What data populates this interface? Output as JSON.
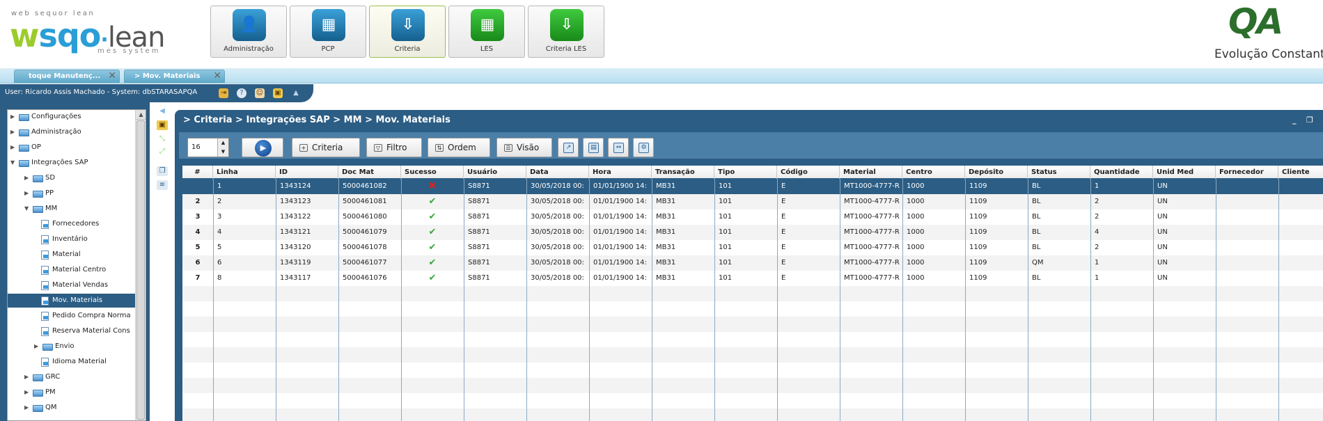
{
  "branding": {
    "tagline": "web sequor lean",
    "logo_w": "w",
    "logo_sqo": "sqo",
    "logo_lean": "lean",
    "logo_sub": "mes system",
    "qa_logo": "QA",
    "slogan": "Evolução Constante"
  },
  "modules": [
    {
      "label": "Administração",
      "icon": "person-icon",
      "color": "blue",
      "glyph": "👤"
    },
    {
      "label": "PCP",
      "icon": "calendar-icon",
      "color": "blue",
      "glyph": "▦"
    },
    {
      "label": "Criteria",
      "icon": "criteria-icon",
      "color": "blue",
      "glyph": "⇩"
    },
    {
      "label": "LES",
      "icon": "grid-icon",
      "color": "green",
      "glyph": "▦"
    },
    {
      "label": "Criteria LES",
      "icon": "criteria-les-icon",
      "color": "green",
      "glyph": "⇩"
    }
  ],
  "tabs": [
    {
      "label": "toque Manutenç..."
    },
    {
      "label": "> Mov. Materiais"
    }
  ],
  "userbar": {
    "text": "User: Ricardo Assis Machado - System: dbSTARASAPQA"
  },
  "tree": [
    {
      "label": "Configurações",
      "level": 0,
      "expander": "▶",
      "type": "folder"
    },
    {
      "label": "Administração",
      "level": 0,
      "expander": "▶",
      "type": "folder"
    },
    {
      "label": "OP",
      "level": 0,
      "expander": "▶",
      "type": "folder"
    },
    {
      "label": "Integrações SAP",
      "level": 0,
      "expander": "▼",
      "type": "folder"
    },
    {
      "label": "SD",
      "level": 1,
      "expander": "▶",
      "type": "folder"
    },
    {
      "label": "PP",
      "level": 1,
      "expander": "▶",
      "type": "folder"
    },
    {
      "label": "MM",
      "level": 1,
      "expander": "▼",
      "type": "folder"
    },
    {
      "label": "Fornecedores",
      "level": 2,
      "expander": "",
      "type": "doc"
    },
    {
      "label": "Inventário",
      "level": 2,
      "expander": "",
      "type": "doc"
    },
    {
      "label": "Material",
      "level": 2,
      "expander": "",
      "type": "doc"
    },
    {
      "label": "Material Centro",
      "level": 2,
      "expander": "",
      "type": "doc"
    },
    {
      "label": "Material Vendas",
      "level": 2,
      "expander": "",
      "type": "doc"
    },
    {
      "label": "Mov. Materiais",
      "level": 2,
      "expander": "",
      "type": "doc",
      "selected": true
    },
    {
      "label": "Pedido Compra Norma",
      "level": 2,
      "expander": "",
      "type": "doc"
    },
    {
      "label": "Reserva Material Cons",
      "level": 2,
      "expander": "",
      "type": "doc"
    },
    {
      "label": "Envio",
      "level": 2,
      "expander": "▶",
      "type": "folder"
    },
    {
      "label": "Idioma Material",
      "level": 2,
      "expander": "",
      "type": "doc"
    },
    {
      "label": "GRC",
      "level": 1,
      "expander": "▶",
      "type": "folder"
    },
    {
      "label": "PM",
      "level": 1,
      "expander": "▶",
      "type": "folder"
    },
    {
      "label": "QM",
      "level": 1,
      "expander": "▶",
      "type": "folder"
    }
  ],
  "panel": {
    "breadcrumb": "> Criteria > Integrações SAP > MM > Mov. Materiais",
    "rows_per_page": "16",
    "buttons": {
      "criteria": "Criteria",
      "filtro": "Filtro",
      "ordem": "Ordem",
      "visao": "Visão"
    }
  },
  "grid": {
    "columns": [
      "#",
      "Linha",
      "ID",
      "Doc Mat",
      "Sucesso",
      "Usuário",
      "Data",
      "Hora",
      "Transação",
      "Tipo",
      "Código",
      "Material",
      "Centro",
      "Depósito",
      "Status",
      "Quantidade",
      "Unid Med",
      "Fornecedor",
      "Cliente"
    ],
    "rows": [
      {
        "idx": "",
        "linha": "1",
        "id": "1343124",
        "docmat": "5000461082",
        "sucesso": false,
        "usuario": "S8871",
        "data": "30/05/2018 00:",
        "hora": "01/01/1900 14:",
        "transacao": "MB31",
        "tipo": "101",
        "codigo": "E",
        "material": "MT1000-4777-R",
        "centro": "1000",
        "deposito": "1109",
        "status": "BL",
        "quantidade": "1",
        "unid": "UN",
        "fornecedor": "",
        "cliente": "",
        "selected": true
      },
      {
        "idx": "2",
        "linha": "2",
        "id": "1343123",
        "docmat": "5000461081",
        "sucesso": true,
        "usuario": "S8871",
        "data": "30/05/2018 00:",
        "hora": "01/01/1900 14:",
        "transacao": "MB31",
        "tipo": "101",
        "codigo": "E",
        "material": "MT1000-4777-R",
        "centro": "1000",
        "deposito": "1109",
        "status": "BL",
        "quantidade": "2",
        "unid": "UN",
        "fornecedor": "",
        "cliente": ""
      },
      {
        "idx": "3",
        "linha": "3",
        "id": "1343122",
        "docmat": "5000461080",
        "sucesso": true,
        "usuario": "S8871",
        "data": "30/05/2018 00:",
        "hora": "01/01/1900 14:",
        "transacao": "MB31",
        "tipo": "101",
        "codigo": "E",
        "material": "MT1000-4777-R",
        "centro": "1000",
        "deposito": "1109",
        "status": "BL",
        "quantidade": "2",
        "unid": "UN",
        "fornecedor": "",
        "cliente": ""
      },
      {
        "idx": "4",
        "linha": "4",
        "id": "1343121",
        "docmat": "5000461079",
        "sucesso": true,
        "usuario": "S8871",
        "data": "30/05/2018 00:",
        "hora": "01/01/1900 14:",
        "transacao": "MB31",
        "tipo": "101",
        "codigo": "E",
        "material": "MT1000-4777-R",
        "centro": "1000",
        "deposito": "1109",
        "status": "BL",
        "quantidade": "4",
        "unid": "UN",
        "fornecedor": "",
        "cliente": ""
      },
      {
        "idx": "5",
        "linha": "5",
        "id": "1343120",
        "docmat": "5000461078",
        "sucesso": true,
        "usuario": "S8871",
        "data": "30/05/2018 00:",
        "hora": "01/01/1900 14:",
        "transacao": "MB31",
        "tipo": "101",
        "codigo": "E",
        "material": "MT1000-4777-R",
        "centro": "1000",
        "deposito": "1109",
        "status": "BL",
        "quantidade": "2",
        "unid": "UN",
        "fornecedor": "",
        "cliente": ""
      },
      {
        "idx": "6",
        "linha": "6",
        "id": "1343119",
        "docmat": "5000461077",
        "sucesso": true,
        "usuario": "S8871",
        "data": "30/05/2018 00:",
        "hora": "01/01/1900 14:",
        "transacao": "MB31",
        "tipo": "101",
        "codigo": "E",
        "material": "MT1000-4777-R",
        "centro": "1000",
        "deposito": "1109",
        "status": "QM",
        "quantidade": "1",
        "unid": "UN",
        "fornecedor": "",
        "cliente": ""
      },
      {
        "idx": "7",
        "linha": "8",
        "id": "1343117",
        "docmat": "5000461076",
        "sucesso": true,
        "usuario": "S8871",
        "data": "30/05/2018 00:",
        "hora": "01/01/1900 14:",
        "transacao": "MB31",
        "tipo": "101",
        "codigo": "E",
        "material": "MT1000-4777-R",
        "centro": "1000",
        "deposito": "1109",
        "status": "BL",
        "quantidade": "1",
        "unid": "UN",
        "fornecedor": "",
        "cliente": ""
      }
    ]
  },
  "colors": {
    "accent": "#2c5d84",
    "brand_green": "#9ccc2c",
    "brand_blue": "#2a9ed6",
    "success": "#3aa83a",
    "error": "#e02020"
  }
}
